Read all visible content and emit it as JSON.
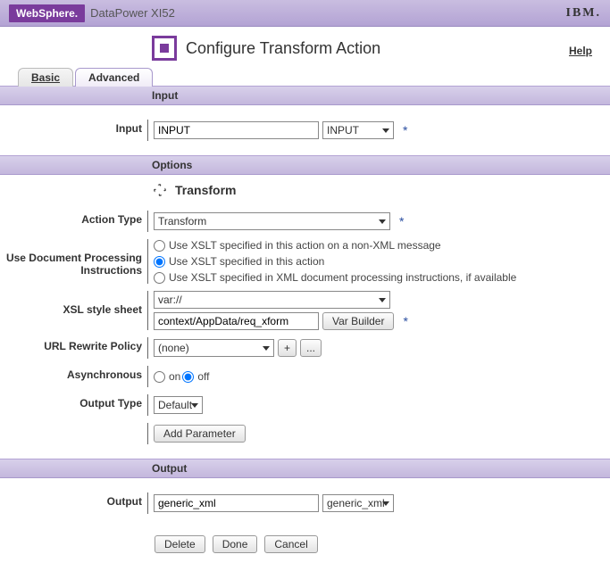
{
  "header": {
    "brand_badge": "WebSphere.",
    "product": "DataPower XI52",
    "vendor": "IBM."
  },
  "title_area": {
    "page_title": "Configure Transform Action",
    "help": "Help"
  },
  "tabs": {
    "basic": "Basic",
    "advanced": "Advanced"
  },
  "sections": {
    "input": "Input",
    "options": "Options",
    "output": "Output"
  },
  "input_row": {
    "label": "Input",
    "text_value": "INPUT",
    "select_value": "INPUT"
  },
  "transform_heading": "Transform",
  "action_type": {
    "label": "Action Type",
    "value": "Transform"
  },
  "dpi": {
    "label": "Use Document Processing Instructions",
    "opt1": "Use XSLT specified in this action on a non-XML message",
    "opt2": "Use XSLT specified in this action",
    "opt3": "Use XSLT specified in XML document processing instructions, if available"
  },
  "xsl": {
    "label": "XSL style sheet",
    "scheme": "var://",
    "path": "context/AppData/req_xform",
    "var_builder": "Var Builder"
  },
  "url_rewrite": {
    "label": "URL Rewrite Policy",
    "value": "(none)",
    "plus": "+",
    "dots": "..."
  },
  "async": {
    "label": "Asynchronous",
    "on": "on",
    "off": "off"
  },
  "output_type": {
    "label": "Output Type",
    "value": "Default"
  },
  "add_param": "Add Parameter",
  "output_row": {
    "label": "Output",
    "text_value": "generic_xml",
    "select_value": "generic_xml"
  },
  "footer": {
    "delete": "Delete",
    "done": "Done",
    "cancel": "Cancel"
  }
}
